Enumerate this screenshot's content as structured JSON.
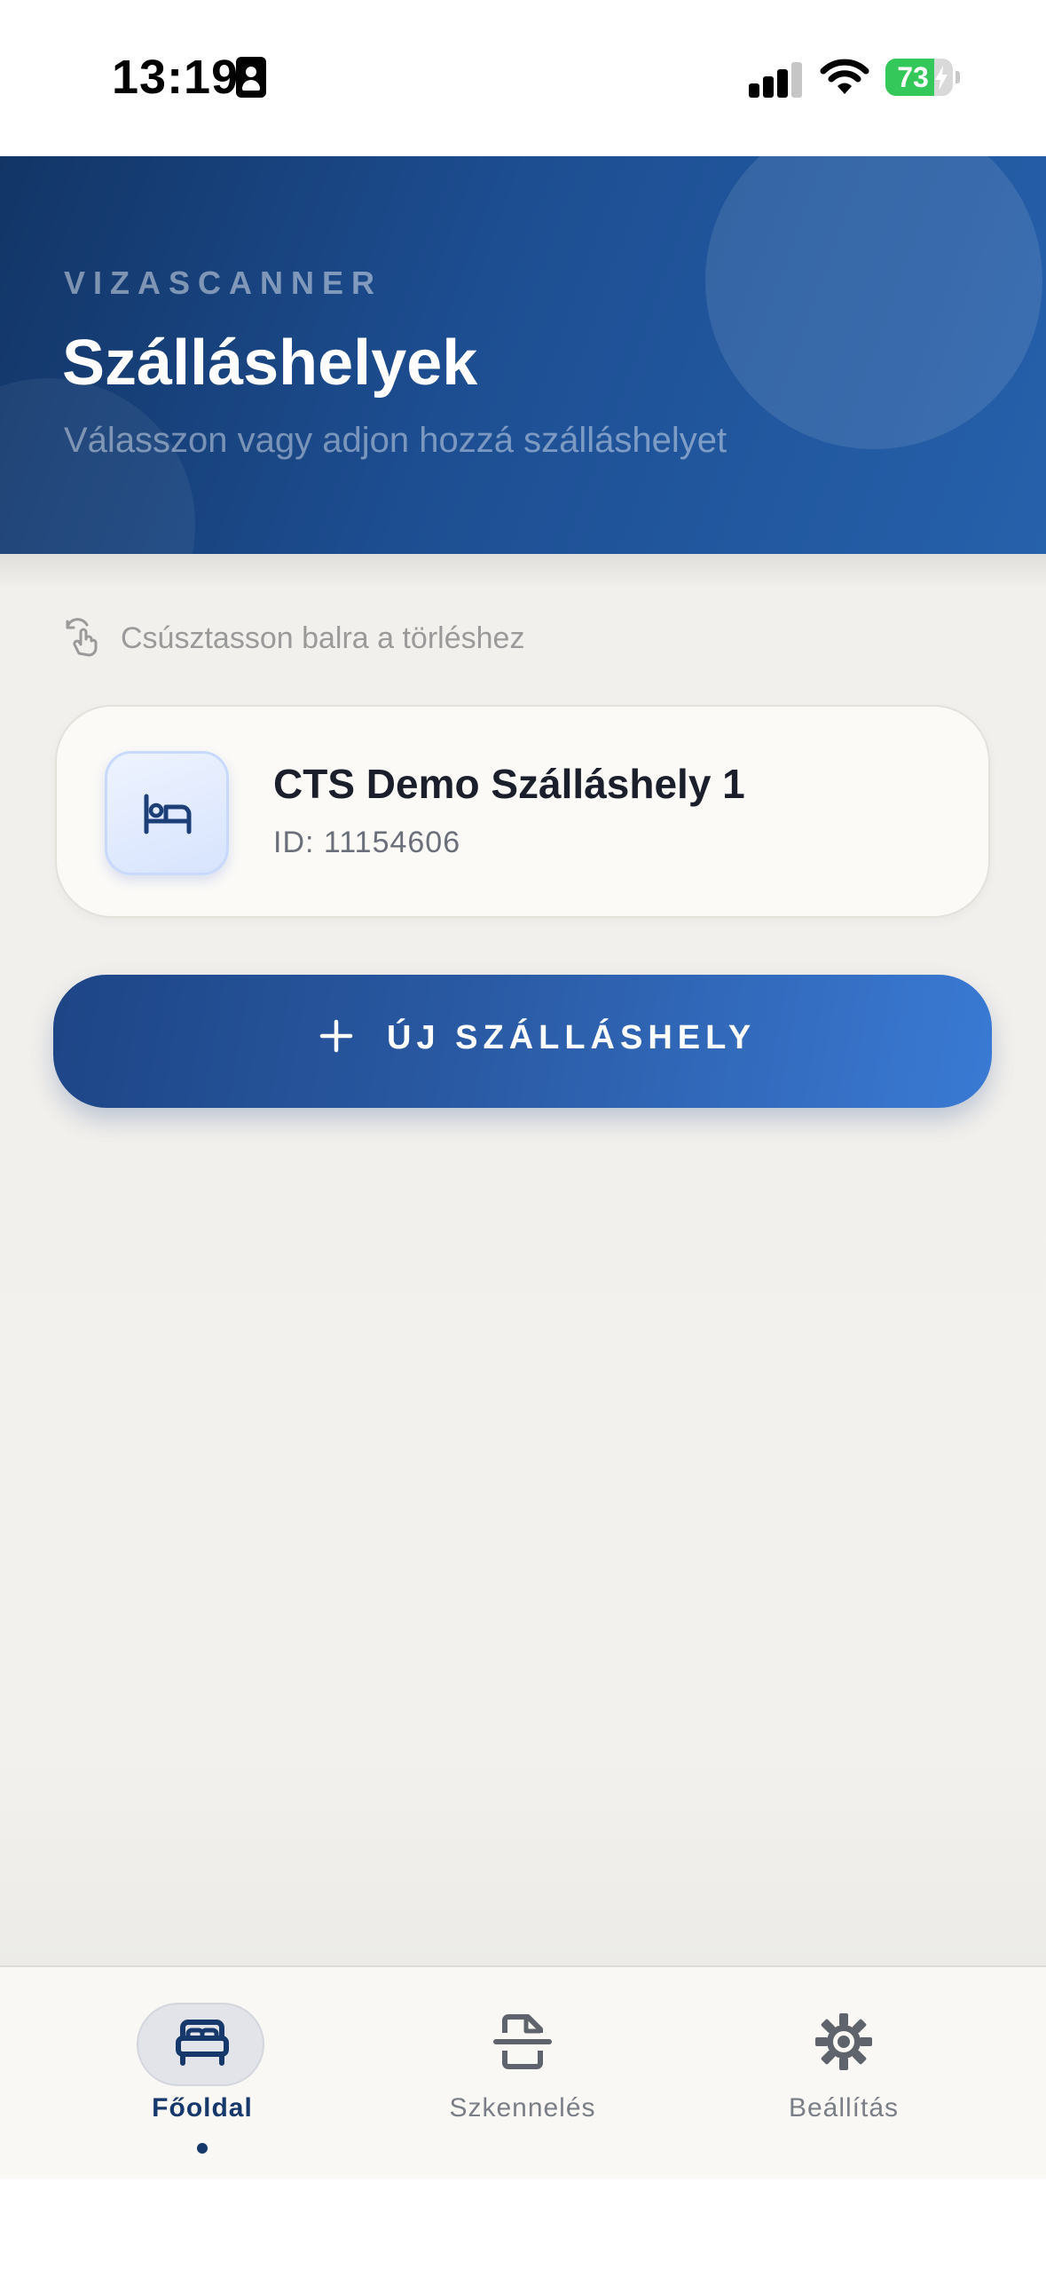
{
  "status_bar": {
    "time": "13:19",
    "battery_level": "73",
    "battery_percent": 73,
    "icons": [
      "id-card-icon",
      "cellular-signal-icon",
      "wifi-icon",
      "battery-charging-icon"
    ]
  },
  "header": {
    "eyebrow": "VIZASCANNER",
    "title": "Szálláshelyek",
    "subtitle": "Válasszon vagy adjon hozzá szálláshelyet"
  },
  "hint": {
    "icon": "swipe-gesture-icon",
    "text": "Csúsztasson balra a törléshez"
  },
  "properties": [
    {
      "icon": "bed-icon",
      "name": "CTS Demo Szálláshely 1",
      "id_text": "ID: 11154606"
    }
  ],
  "new_button": {
    "icon": "plus-icon",
    "label": "ÚJ SZÁLLÁSHELY"
  },
  "tabs": [
    {
      "icon": "bed-icon",
      "label": "Főoldal",
      "active": true
    },
    {
      "icon": "document-scan-icon",
      "label": "Szkennelés",
      "active": false
    },
    {
      "icon": "gear-icon",
      "label": "Beállítás",
      "active": false
    }
  ],
  "colors": {
    "header_dark": "#123566",
    "header_light": "#2661ab",
    "accent": "#17386b",
    "button_end": "#3a7ad4",
    "background": "#f2f0ec",
    "battery_green": "#34c759"
  }
}
